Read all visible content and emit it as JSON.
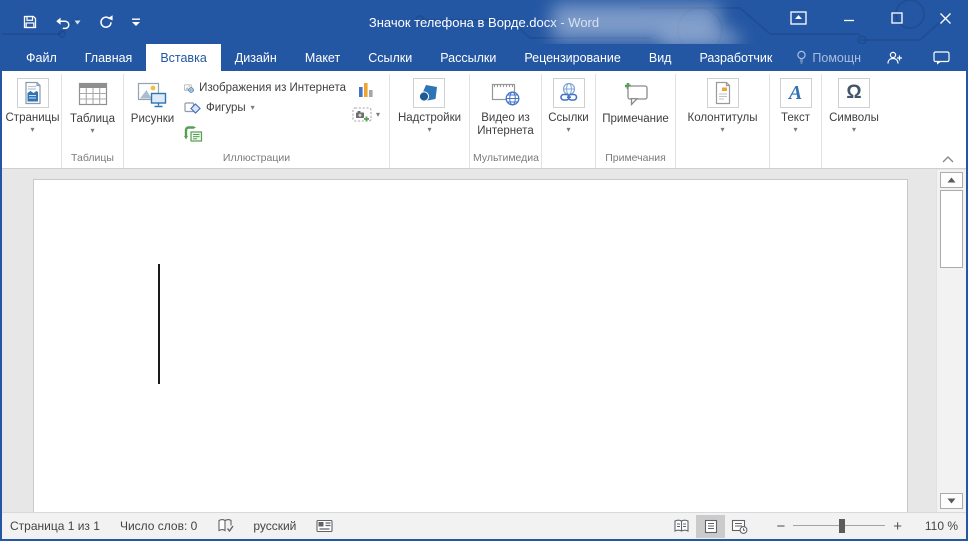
{
  "app": {
    "title": "Значок телефона в Ворде.docx - Word",
    "accent": "#2457a3"
  },
  "tabs": {
    "items": [
      "Файл",
      "Главная",
      "Вставка",
      "Дизайн",
      "Макет",
      "Ссылки",
      "Рассылки",
      "Рецензирование",
      "Вид",
      "Разработчик"
    ],
    "active": "Вставка",
    "assistant": "Помощн"
  },
  "ribbon": {
    "pages_label": "Страницы",
    "tables_group": "Таблицы",
    "table_label": "Таблица",
    "illustrations_group": "Иллюстрации",
    "pictures_label": "Рисунки",
    "online_pictures_label": "Изображения из Интернета",
    "shapes_label": "Фигуры",
    "addins_label": "Надстройки",
    "media_group": "Мультимедиа",
    "video_label": "Видео из Интернета",
    "links_label": "Ссылки",
    "comments_group": "Примечания",
    "comment_label": "Примечание",
    "header_footer_label": "Колонтитулы",
    "text_label": "Текст",
    "symbols_label": "Символы"
  },
  "icons": {
    "dropdown": "▾",
    "text_a": "A",
    "omega": "Ω"
  },
  "statusbar": {
    "page": "Страница 1 из 1",
    "words": "Число слов: 0",
    "language": "русский",
    "zoom": "110 %"
  }
}
